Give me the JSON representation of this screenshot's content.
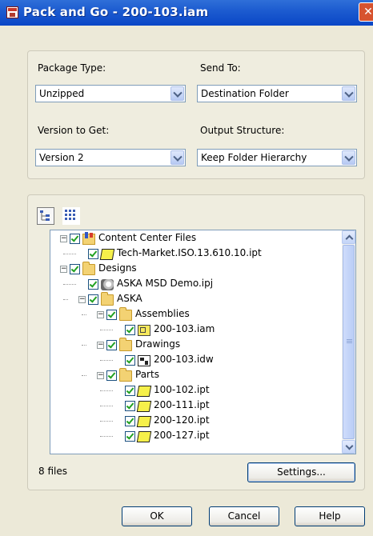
{
  "window": {
    "title": "Pack and Go - 200-103.iam",
    "close_glyph": "✕"
  },
  "options": {
    "package_type": {
      "label": "Package Type:",
      "value": "Unzipped"
    },
    "send_to": {
      "label": "Send To:",
      "value": "Destination Folder"
    },
    "version": {
      "label": "Version to Get:",
      "value": "Version 2"
    },
    "output_structure": {
      "label": "Output Structure:",
      "value": "Keep Folder Hierarchy"
    }
  },
  "tree": {
    "items": [
      {
        "label": "Content Center Files",
        "icon": "content-center-icon",
        "level": 0,
        "expander": "−"
      },
      {
        "label": "Tech-Market.ISO.13.610.10.ipt",
        "icon": "part-icon",
        "level": 1,
        "expander": ""
      },
      {
        "label": "Designs",
        "icon": "folder-icon",
        "level": 0,
        "expander": "−"
      },
      {
        "label": "ASKA MSD Demo.ipj",
        "icon": "project-icon",
        "level": 1,
        "expander": ""
      },
      {
        "label": "ASKA",
        "icon": "folder-icon",
        "level": 1,
        "expander": "−"
      },
      {
        "label": "Assemblies",
        "icon": "folder-icon",
        "level": 2,
        "expander": "−"
      },
      {
        "label": "200-103.iam",
        "icon": "assembly-icon",
        "level": 3,
        "expander": ""
      },
      {
        "label": "Drawings",
        "icon": "folder-icon",
        "level": 2,
        "expander": "−"
      },
      {
        "label": "200-103.idw",
        "icon": "drawing-icon",
        "level": 3,
        "expander": ""
      },
      {
        "label": "Parts",
        "icon": "folder-icon",
        "level": 2,
        "expander": "−"
      },
      {
        "label": "100-102.ipt",
        "icon": "part-icon",
        "level": 3,
        "expander": ""
      },
      {
        "label": "200-111.ipt",
        "icon": "part-icon",
        "level": 3,
        "expander": ""
      },
      {
        "label": "200-120.ipt",
        "icon": "part-icon",
        "level": 3,
        "expander": ""
      },
      {
        "label": "200-127.ipt",
        "icon": "part-icon",
        "level": 3,
        "expander": ""
      }
    ]
  },
  "status": {
    "file_count": "8 files"
  },
  "buttons": {
    "settings": "Settings...",
    "ok": "OK",
    "cancel": "Cancel",
    "help": "Help"
  },
  "colors": {
    "title_bar": "#0a46c6",
    "dialog_bg": "#ece9d8",
    "field_border": "#7f9db9"
  }
}
